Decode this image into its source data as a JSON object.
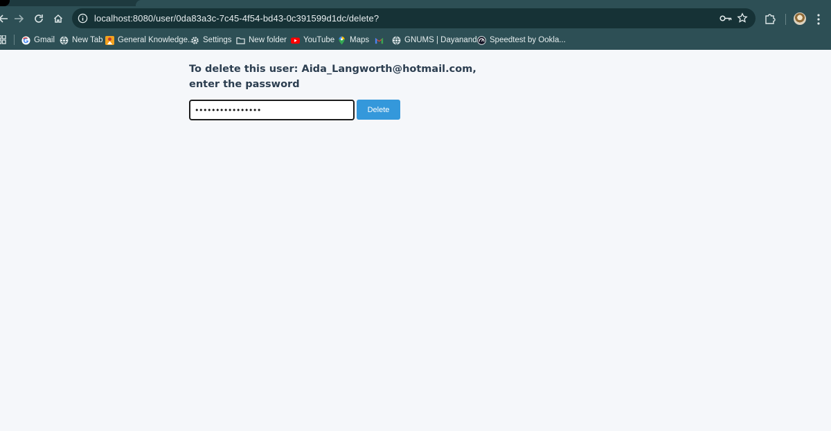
{
  "browser": {
    "url": "localhost:8080/user/0da83a3c-7c45-4f54-bd43-0c391599d1dc/delete?",
    "bookmarks": [
      {
        "label": "Gmail",
        "icon": "google-icon"
      },
      {
        "label": "New Tab",
        "icon": "globe-icon"
      },
      {
        "label": "General Knowledge...",
        "icon": "gk-icon"
      },
      {
        "label": "Settings",
        "icon": "gear-icon"
      },
      {
        "label": "New folder",
        "icon": "folder-icon"
      },
      {
        "label": "YouTube",
        "icon": "youtube-icon"
      },
      {
        "label": "Maps",
        "icon": "maps-icon"
      },
      {
        "label": "",
        "icon": "gmail-icon"
      },
      {
        "label": "GNUMS | Dayanand...",
        "icon": "globe-icon"
      },
      {
        "label": "Speedtest by Ookla...",
        "icon": "speedtest-icon"
      }
    ]
  },
  "page": {
    "prompt_line1": "To delete this user: Aida_Langworth@hotmail.com,",
    "prompt_line2": "enter the password",
    "password_value": "••••••••••••••••",
    "delete_label": "Delete"
  },
  "colors": {
    "accent": "#3498db",
    "heading": "#2c3e50",
    "chrome": "#2d4f55"
  }
}
